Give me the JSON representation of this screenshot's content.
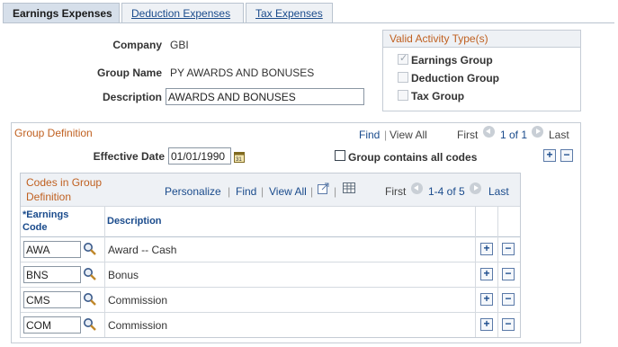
{
  "tabs": [
    {
      "label": "Earnings Expenses",
      "active": true
    },
    {
      "label": "Deduction Expenses",
      "active": false
    },
    {
      "label": "Tax Expenses",
      "active": false
    }
  ],
  "header": {
    "company_label": "Company",
    "company_value": "GBI",
    "group_name_label": "Group Name",
    "group_name_value": "PY AWARDS AND BONUSES",
    "description_label": "Description",
    "description_value": "AWARDS AND BONUSES"
  },
  "activity": {
    "title": "Valid Activity Type(s)",
    "items": [
      {
        "label": "Earnings Group",
        "checked": true
      },
      {
        "label": "Deduction Group",
        "checked": false
      },
      {
        "label": "Tax Group",
        "checked": false
      }
    ]
  },
  "group_definition": {
    "title": "Group Definition",
    "find": "Find",
    "view_all": "View All",
    "first": "First",
    "range": "1 of 1",
    "last": "Last",
    "effective_date_label": "Effective Date",
    "effective_date_value": "01/01/1990",
    "all_codes_label": "Group contains all codes"
  },
  "codes_grid": {
    "title_line1": "Codes in Group",
    "title_line2": "Definition",
    "personalize": "Personalize",
    "find": "Find",
    "view_all": "View All",
    "first": "First",
    "range": "1-4 of 5",
    "last": "Last",
    "col_code_line1": "*Earnings",
    "col_code_line2": "Code",
    "col_description": "Description",
    "rows": [
      {
        "code": "AWA",
        "description": "Award -- Cash"
      },
      {
        "code": "BNS",
        "description": "Bonus"
      },
      {
        "code": "CMS",
        "description": "Commission"
      },
      {
        "code": "COM",
        "description": "Commission"
      }
    ]
  },
  "icons": {
    "plus": "+",
    "minus": "−",
    "separator": "|"
  },
  "colors": {
    "link": "#1a4b8c",
    "section_title": "#c06020",
    "active_tab": "#d6dfea"
  }
}
